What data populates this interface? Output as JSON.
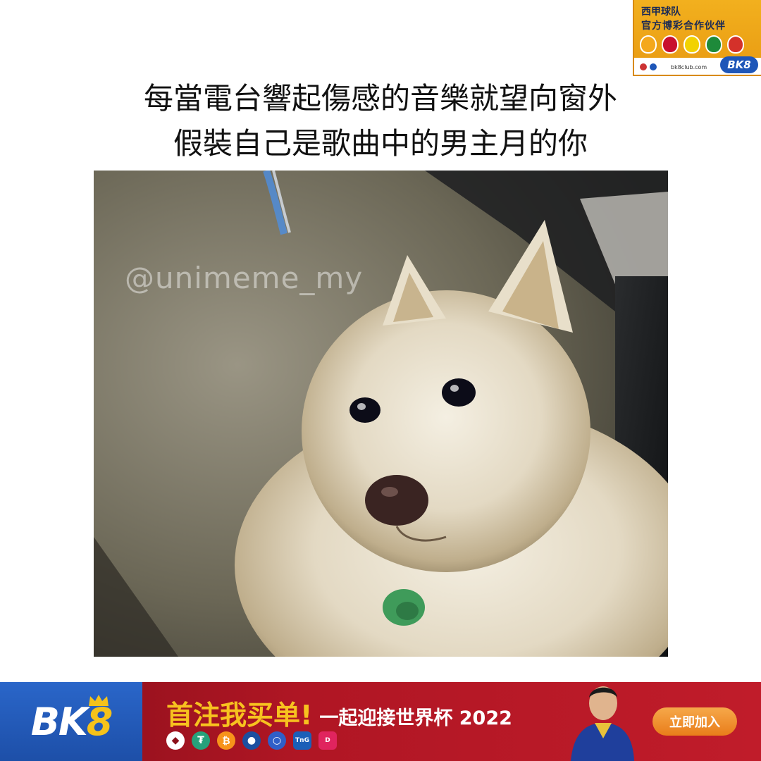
{
  "sponsor": {
    "line1": "西甲球队",
    "line2": "官方博彩合作伙伴",
    "url": "bk8club.com",
    "logo": "BK8",
    "crest_colors": [
      "#f4a81c",
      "#c8102e",
      "#f2d200",
      "#1e8a3a",
      "#d4312a"
    ]
  },
  "caption": {
    "line1": "每當電台響起傷感的音樂就望向窗外",
    "line2": "假裝自己是歌曲中的男主月的你"
  },
  "photo": {
    "subject": "white-fluffy-dog-at-car-window",
    "watermark": "@unimeme_my"
  },
  "banner": {
    "logo_prefix": "BK",
    "logo_suffix": "8",
    "headline_main": "首注我买单!",
    "headline_sub": "一起迎接世界杯 2022",
    "payment_icons": [
      "ethereum-icon",
      "tether-icon",
      "bitcoin-icon",
      "water-drop-icon",
      "circle-icon",
      "touch-n-go-icon",
      "duitnow-icon"
    ],
    "cta_label": "立即加入",
    "colors": {
      "red": "#b01624",
      "blue": "#1d4fa8",
      "gold": "#f7c21f",
      "orange": "#e97d1a"
    }
  }
}
